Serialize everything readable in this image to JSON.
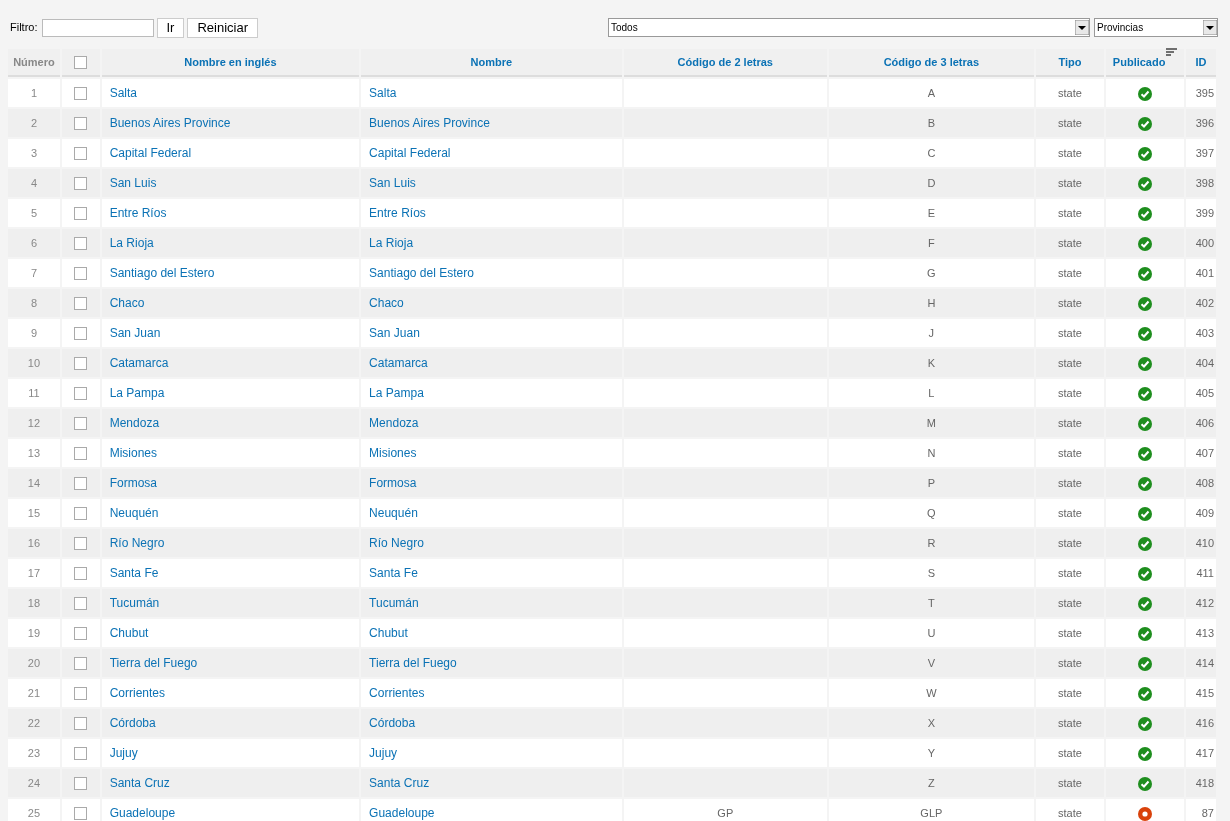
{
  "filter": {
    "label": "Filtro:",
    "buttons": [
      "Ir",
      "Reiniciar"
    ]
  },
  "dropdowns": [
    {
      "value": "Todos"
    },
    {
      "value": "Provincias"
    }
  ],
  "table": {
    "columns": [
      {
        "label": "Número",
        "kind": "number"
      },
      {
        "kind": "check",
        "checked": false
      },
      {
        "label": "Nombre en inglés",
        "kind": "text"
      },
      {
        "label": "Nombre",
        "kind": "text"
      },
      {
        "label": "Código de 2 letras",
        "kind": "text"
      },
      {
        "label": "Código de 3 letras",
        "kind": "text"
      },
      {
        "label": "Tipo",
        "kind": "text"
      },
      {
        "label": "Publicado",
        "kind": "text",
        "sorted": true
      },
      {
        "label": "ID",
        "kind": "text"
      }
    ],
    "rows": [
      {
        "number": "1",
        "checked": false,
        "english": "Salta",
        "name": "Salta",
        "code3": "A",
        "type": "state",
        "published": true,
        "id": "395"
      },
      {
        "number": "2",
        "checked": false,
        "english": "Buenos Aires Province",
        "name": "Buenos Aires Province",
        "code3": "B",
        "type": "state",
        "published": true,
        "id": "396"
      },
      {
        "number": "3",
        "checked": false,
        "english": "Capital Federal",
        "name": "Capital Federal",
        "code3": "C",
        "type": "state",
        "published": true,
        "id": "397"
      },
      {
        "number": "4",
        "checked": false,
        "english": "San Luis",
        "name": "San Luis",
        "code3": "D",
        "type": "state",
        "published": true,
        "id": "398"
      },
      {
        "number": "5",
        "checked": false,
        "english": "Entre Ríos",
        "name": "Entre Ríos",
        "code3": "E",
        "type": "state",
        "published": true,
        "id": "399"
      },
      {
        "number": "6",
        "checked": false,
        "english": "La Rioja",
        "name": "La Rioja",
        "code3": "F",
        "type": "state",
        "published": true,
        "id": "400"
      },
      {
        "number": "7",
        "checked": false,
        "english": "Santiago del Estero",
        "name": "Santiago del Estero",
        "code3": "G",
        "type": "state",
        "published": true,
        "id": "401"
      },
      {
        "number": "8",
        "checked": false,
        "english": "Chaco",
        "name": "Chaco",
        "code3": "H",
        "type": "state",
        "published": true,
        "id": "402"
      },
      {
        "number": "9",
        "checked": false,
        "english": "San Juan",
        "name": "San Juan",
        "code3": "J",
        "type": "state",
        "published": true,
        "id": "403"
      },
      {
        "number": "10",
        "checked": false,
        "english": "Catamarca",
        "name": "Catamarca",
        "code3": "K",
        "type": "state",
        "published": true,
        "id": "404"
      },
      {
        "number": "11",
        "checked": false,
        "english": "La Pampa",
        "name": "La Pampa",
        "code3": "L",
        "type": "state",
        "published": true,
        "id": "405"
      },
      {
        "number": "12",
        "checked": false,
        "english": "Mendoza",
        "name": "Mendoza",
        "code3": "M",
        "type": "state",
        "published": true,
        "id": "406"
      },
      {
        "number": "13",
        "checked": false,
        "english": "Misiones",
        "name": "Misiones",
        "code3": "N",
        "type": "state",
        "published": true,
        "id": "407"
      },
      {
        "number": "14",
        "checked": false,
        "english": "Formosa",
        "name": "Formosa",
        "code3": "P",
        "type": "state",
        "published": true,
        "id": "408"
      },
      {
        "number": "15",
        "checked": false,
        "english": "Neuquén",
        "name": "Neuquén",
        "code3": "Q",
        "type": "state",
        "published": true,
        "id": "409"
      },
      {
        "number": "16",
        "checked": false,
        "english": "Río Negro",
        "name": "Río Negro",
        "code3": "R",
        "type": "state",
        "published": true,
        "id": "410"
      },
      {
        "number": "17",
        "checked": false,
        "english": "Santa Fe",
        "name": "Santa Fe",
        "code3": "S",
        "type": "state",
        "published": true,
        "id": "411"
      },
      {
        "number": "18",
        "checked": false,
        "english": "Tucumán",
        "name": "Tucumán",
        "code3": "T",
        "type": "state",
        "published": true,
        "id": "412"
      },
      {
        "number": "19",
        "checked": false,
        "english": "Chubut",
        "name": "Chubut",
        "code3": "U",
        "type": "state",
        "published": true,
        "id": "413"
      },
      {
        "number": "20",
        "checked": false,
        "english": "Tierra del Fuego",
        "name": "Tierra del Fuego",
        "code3": "V",
        "type": "state",
        "published": true,
        "id": "414"
      },
      {
        "number": "21",
        "checked": false,
        "english": "Corrientes",
        "name": "Corrientes",
        "code3": "W",
        "type": "state",
        "published": true,
        "id": "415"
      },
      {
        "number": "22",
        "checked": false,
        "english": "Córdoba",
        "name": "Córdoba",
        "code3": "X",
        "type": "state",
        "published": true,
        "id": "416"
      },
      {
        "number": "23",
        "checked": false,
        "english": "Jujuy",
        "name": "Jujuy",
        "code3": "Y",
        "type": "state",
        "published": true,
        "id": "417"
      },
      {
        "number": "24",
        "checked": false,
        "english": "Santa Cruz",
        "name": "Santa Cruz",
        "code3": "Z",
        "type": "state",
        "published": true,
        "id": "418"
      },
      {
        "number": "25",
        "checked": false,
        "english": "Guadeloupe",
        "name": "Guadeloupe",
        "code2": "GP",
        "code3": "GLP",
        "type": "state",
        "published": false,
        "id": "87"
      }
    ]
  }
}
